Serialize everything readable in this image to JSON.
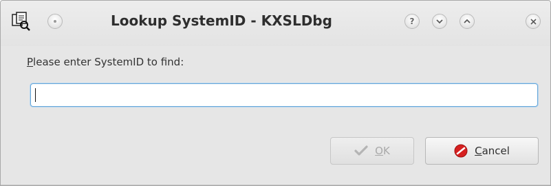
{
  "window": {
    "title": "Lookup SystemID - KXSLDbg",
    "app_icon": "kxsldbg-app-icon",
    "titlebar_buttons": {
      "menu": "window-menu-icon",
      "help": "?",
      "minimize": "minimize-chevron-down-icon",
      "maximize": "maximize-chevron-up-icon",
      "close": "close-x-icon"
    }
  },
  "dialog": {
    "prompt_mnemonic": "P",
    "prompt_rest": "lease enter SystemID to find:",
    "input": {
      "value": "",
      "placeholder": ""
    }
  },
  "buttons": {
    "ok": {
      "mnemonic": "O",
      "rest": "K",
      "enabled": false,
      "icon": "checkmark-icon"
    },
    "cancel": {
      "mnemonic": "C",
      "rest": "ancel",
      "enabled": true,
      "icon": "cancel-stop-icon"
    }
  },
  "colors": {
    "window_bg": "#e6e6e6",
    "input_focus_border": "#68a7d8",
    "cancel_icon_red": "#d62020",
    "disabled_text": "#a9a9a9"
  }
}
